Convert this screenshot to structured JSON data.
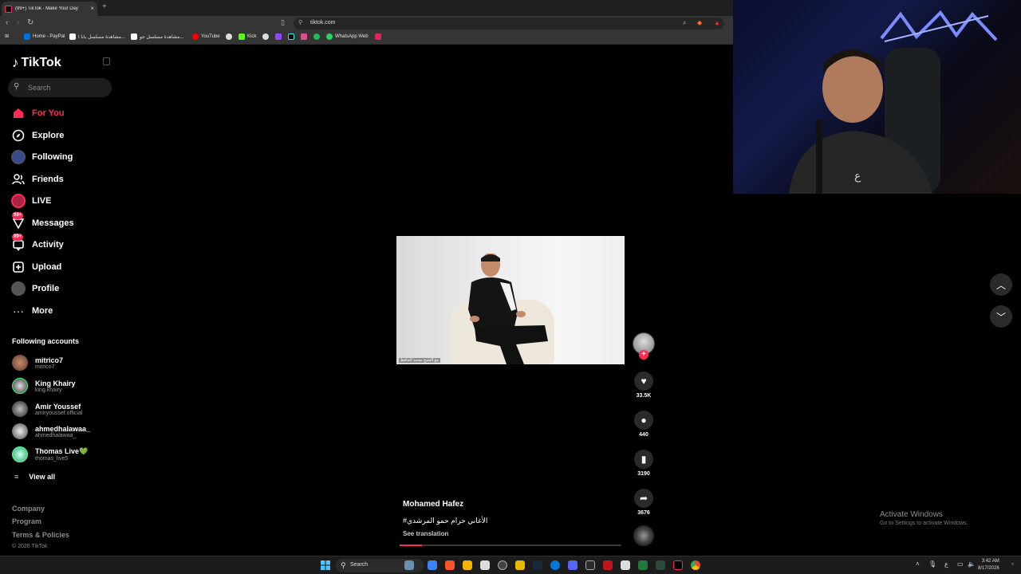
{
  "browser": {
    "tab_title": "(99+) TikTok - Make Your Day",
    "url": "tiktok.com",
    "bookmarks": [
      "Home - PayPal",
      "مشاهدة مسلسل بابا ا...",
      "مشاهدة مسلسل جو...",
      "YouTube",
      "Kick",
      "WhatsApp Web"
    ]
  },
  "tiktok": {
    "logo": "TikTok",
    "search_placeholder": "Search",
    "nav": [
      {
        "label": "For You",
        "icon": "home-icon",
        "active": true
      },
      {
        "label": "Explore",
        "icon": "compass-icon"
      },
      {
        "label": "Following",
        "icon": "following-avatar-icon"
      },
      {
        "label": "Friends",
        "icon": "friends-icon"
      },
      {
        "label": "LIVE",
        "icon": "live-icon"
      },
      {
        "label": "Messages",
        "icon": "messages-icon",
        "badge": "99+"
      },
      {
        "label": "Activity",
        "icon": "activity-icon",
        "badge": "99+"
      },
      {
        "label": "Upload",
        "icon": "upload-icon"
      },
      {
        "label": "Profile",
        "icon": "profile-icon"
      },
      {
        "label": "More",
        "icon": "more-icon"
      }
    ],
    "following_title": "Following accounts",
    "accounts": [
      {
        "name": "mitrico7",
        "handle": "mitrico7"
      },
      {
        "name": "King Khairy",
        "handle": "king.khairy"
      },
      {
        "name": "Amir Youssef",
        "handle": "amiryoussef.official"
      },
      {
        "name": "ahmedhalawaa_",
        "handle": "ahmedhalawaa_"
      },
      {
        "name": "Thomas Live💚",
        "handle": "thomas_live5"
      }
    ],
    "view_all": "View all",
    "footer": [
      "Company",
      "Program",
      "Terms & Policies"
    ],
    "copyright": "© 2026 TikTok"
  },
  "video": {
    "author": "Mohamed Hafez",
    "caption": "#الأغاني حرام حمو    المرشدي",
    "see_translation": "See translation",
    "subtitle": "مع الشيخ محمد الحافظ",
    "progress": 0.1,
    "likes": "33.5K",
    "comments": "440",
    "bookmarks": "3190",
    "shares": "3676"
  },
  "overlay": {
    "activate_title": "Activate Windows",
    "activate_sub": "Go to Settings to activate Windows."
  },
  "taskbar": {
    "search": "Search",
    "time": "3:42 AM",
    "date": "8/17/2026"
  }
}
